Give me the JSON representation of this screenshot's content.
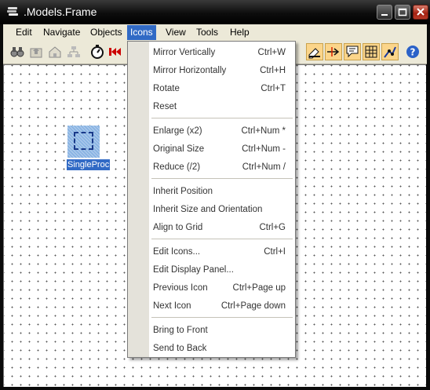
{
  "window": {
    "title": ".Models.Frame",
    "icon": "app-stack-icon",
    "controls": [
      "minimize-icon",
      "maximize-icon",
      "close-icon"
    ]
  },
  "menubar": {
    "items": [
      "Edit",
      "Navigate",
      "Objects",
      "Icons",
      "View",
      "Tools",
      "Help"
    ],
    "active": "Icons"
  },
  "toolbar": {
    "left_icons": [
      "binoculars-icon",
      "go-up-icon",
      "home-icon",
      "hierarchy-icon",
      "stopwatch-icon",
      "rewind-icon"
    ],
    "right_icons": [
      "editor-icon",
      "connection-arrow-icon",
      "comment-icon",
      "grid-icon",
      "auto-route-icon",
      "help-icon"
    ]
  },
  "canvas": {
    "block_label": "SingleProc"
  },
  "icons_menu": {
    "groups": [
      [
        {
          "label": "Mirror Vertically",
          "shortcut": "Ctrl+W"
        },
        {
          "label": "Mirror Horizontally",
          "shortcut": "Ctrl+H"
        },
        {
          "label": "Rotate",
          "shortcut": "Ctrl+T"
        },
        {
          "label": "Reset",
          "shortcut": ""
        }
      ],
      [
        {
          "label": "Enlarge (x2)",
          "shortcut": "Ctrl+Num *"
        },
        {
          "label": "Original Size",
          "shortcut": "Ctrl+Num -"
        },
        {
          "label": "Reduce (/2)",
          "shortcut": "Ctrl+Num /"
        }
      ],
      [
        {
          "label": "Inherit Position",
          "shortcut": ""
        },
        {
          "label": "Inherit Size and Orientation",
          "shortcut": ""
        },
        {
          "label": "Align to Grid",
          "shortcut": "Ctrl+G"
        }
      ],
      [
        {
          "label": "Edit Icons...",
          "shortcut": "Ctrl+I"
        },
        {
          "label": "Edit Display Panel...",
          "shortcut": ""
        },
        {
          "label": "Previous Icon",
          "shortcut": "Ctrl+Page up"
        },
        {
          "label": "Next Icon",
          "shortcut": "Ctrl+Page down"
        }
      ],
      [
        {
          "label": "Bring to Front",
          "shortcut": ""
        },
        {
          "label": "Send to Back",
          "shortcut": ""
        }
      ]
    ]
  },
  "colors": {
    "menu_highlight": "#316ac5",
    "toolbar_bg": "#ece9d8",
    "titlebar": "#000000"
  }
}
